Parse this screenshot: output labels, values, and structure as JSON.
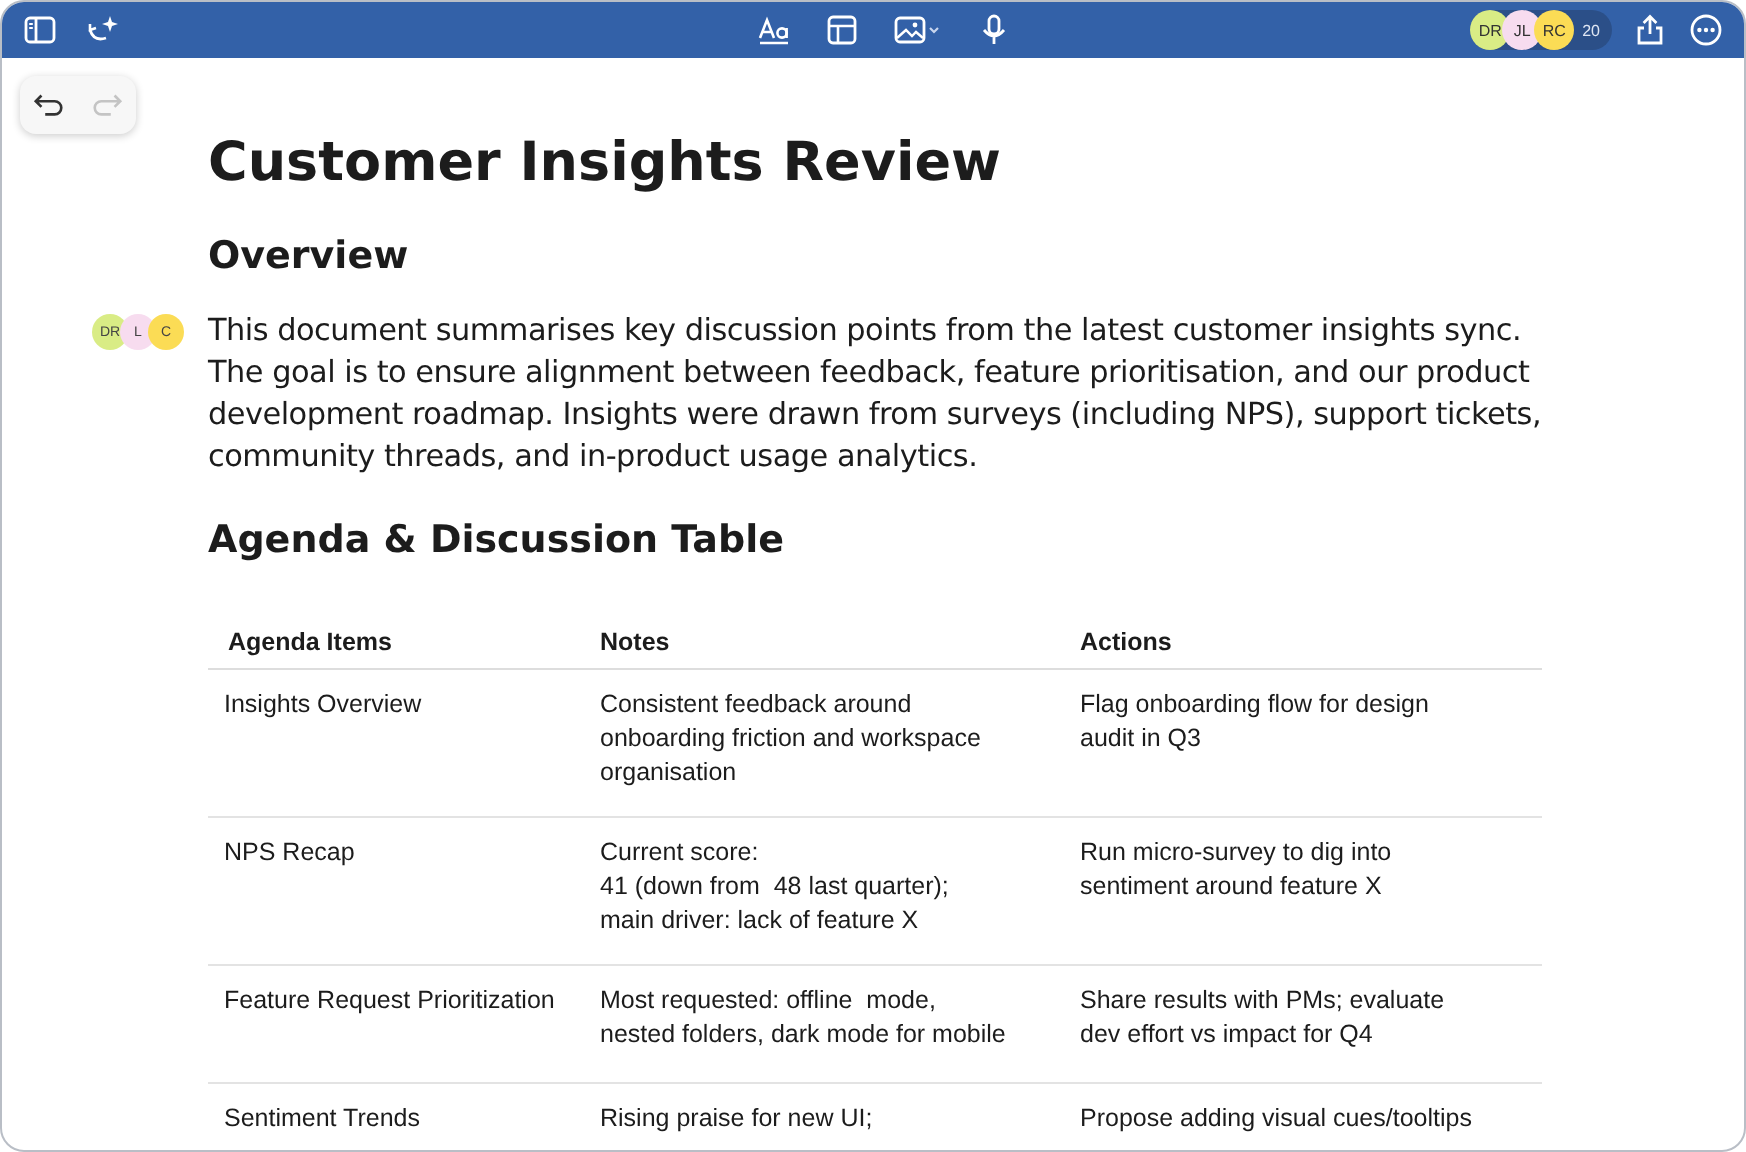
{
  "toolbar": {
    "collaborators": [
      {
        "initials": "DR",
        "color": "#d9ec85"
      },
      {
        "initials": "JL",
        "color": "#f7dcef"
      },
      {
        "initials": "RC",
        "color": "#fbdc55"
      }
    ],
    "collaborator_count": "20"
  },
  "history": {
    "undo_disabled": false,
    "redo_disabled": true
  },
  "document": {
    "title": "Customer Insights Review",
    "overview_heading": "Overview",
    "presence": [
      {
        "initials": "DR",
        "color": "#d9ec85"
      },
      {
        "initials": "L",
        "color": "#f7dcef"
      },
      {
        "initials": "C",
        "color": "#fbdc55"
      }
    ],
    "paragraph": "This document summarises key discussion points from the latest customer insights sync. The goal is to ensure alignment between feedback, feature prioritisation, and our product development roadmap. Insights were drawn from surveys (including NPS), support tickets, community threads, and in-product usage analytics.",
    "table_heading": "Agenda & Discussion Table",
    "table": {
      "columns": [
        "Agenda Items",
        "Notes",
        "Actions"
      ],
      "rows": [
        {
          "cells": [
            "Insights Overview",
            "Consistent feedback around\nonboarding friction and workspace\norganisation",
            "Flag onboarding flow for design\naudit in Q3"
          ]
        },
        {
          "cells": [
            "NPS Recap",
            "Current score:\n41 (down from  48 last quarter);\nmain driver: lack of feature X",
            "Run micro-survey to dig into\nsentiment around feature X"
          ]
        },
        {
          "cells": [
            "Feature Request Prioritization",
            "Most requested: offline  mode,\nnested folders, dark mode for mobile",
            "Share results with PMs; evaluate\ndev effort vs impact for Q4"
          ]
        },
        {
          "cells": [
            "Sentiment Trends",
            "Rising praise for new UI;",
            "Propose adding visual cues/tooltips"
          ]
        }
      ]
    }
  }
}
